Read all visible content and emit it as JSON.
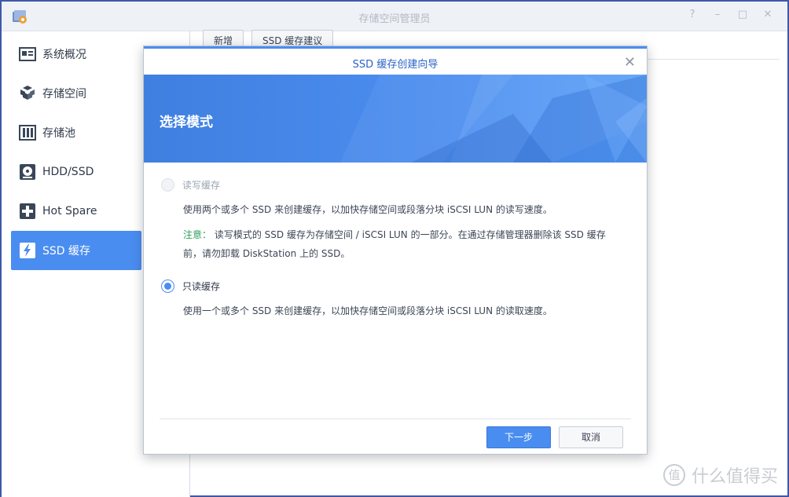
{
  "window": {
    "title": "存储空间管理员",
    "help_icon": "?",
    "minimize_icon": "–",
    "maximize_icon": "□",
    "close_icon": "✕"
  },
  "sidebar": {
    "items": [
      {
        "label": "系统概况",
        "icon": "overview-icon"
      },
      {
        "label": "存储空间",
        "icon": "volume-icon"
      },
      {
        "label": "存储池",
        "icon": "pool-icon"
      },
      {
        "label": "HDD/SSD",
        "icon": "disk-icon"
      },
      {
        "label": "Hot Spare",
        "icon": "hot-spare-icon"
      },
      {
        "label": "SSD 缓存",
        "icon": "ssd-cache-icon",
        "active": true
      }
    ]
  },
  "toolbar": {
    "create_label": "新增",
    "advisor_label": "SSD 缓存建议"
  },
  "dialog": {
    "title": "SSD 缓存创建向导",
    "close": "✕",
    "step_title": "选择模式",
    "options": [
      {
        "label": "读写缓存",
        "disabled": true,
        "checked": false,
        "desc": "使用两个或多个 SSD 来创建缓存，以加快存储空间或段落分块 iSCSI LUN 的读写速度。",
        "note_label": "注意：",
        "note_text": "读写模式的 SSD 缓存为存储空间 / iSCSI LUN 的一部分。在通过存储管理器删除该 SSD 缓存前，请勿卸载 DiskStation 上的 SSD。"
      },
      {
        "label": "只读缓存",
        "disabled": false,
        "checked": true,
        "desc": "使用一个或多个 SSD 来创建缓存，以加快存储空间或段落分块 iSCSI LUN 的读取速度。"
      }
    ],
    "next_label": "下一步",
    "cancel_label": "取消"
  },
  "watermark": {
    "glyph": "值",
    "text": "什么值得买"
  },
  "colors": {
    "accent": "#4a8df0",
    "title_blue": "#2a62c7",
    "note_green": "#2e9e5b",
    "frame": "#3e57a8"
  }
}
